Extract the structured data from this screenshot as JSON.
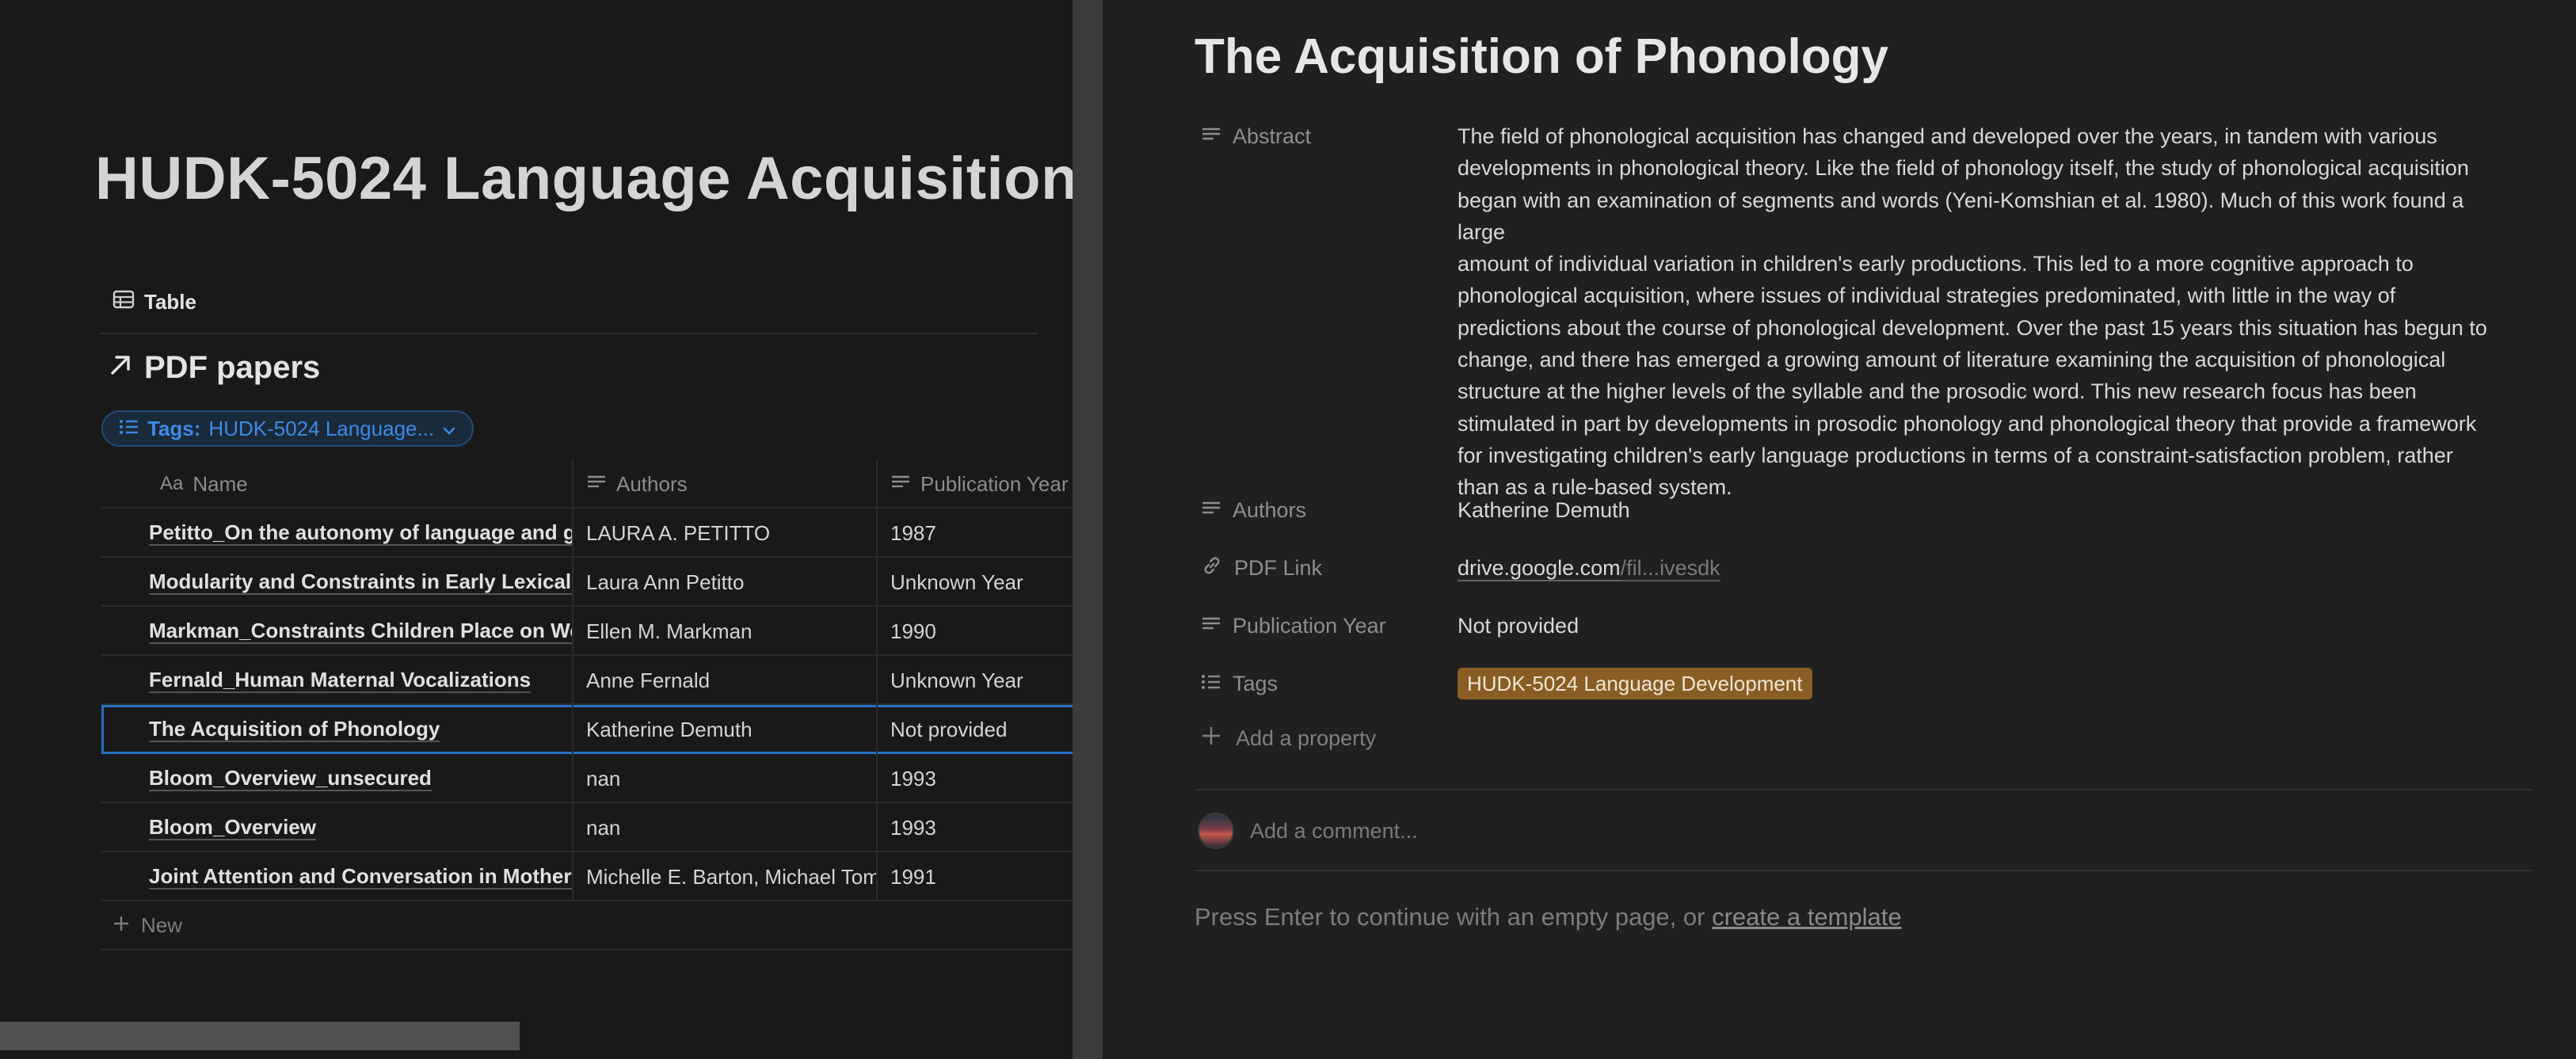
{
  "left": {
    "page_title": "HUDK-5024 Language Acquisition",
    "view_tab": "Table",
    "database_title": "PDF papers",
    "filter": {
      "key": "Tags:",
      "value": "HUDK-5024 Language..."
    },
    "columns": [
      "Name",
      "Authors",
      "Publication Year"
    ],
    "rows": [
      {
        "name": "Petitto_On the autonomy of language and gesture",
        "authors": "LAURA A. PETITTO",
        "year": "1987"
      },
      {
        "name": "Modularity and Constraints in Early Lexical Acquisition",
        "authors": "Laura Ann Petitto",
        "year": "Unknown Year"
      },
      {
        "name": "Markman_Constraints Children Place on Word Meanings",
        "authors": "Ellen M. Markman",
        "year": "1990"
      },
      {
        "name": "Fernald_Human Maternal Vocalizations",
        "authors": "Anne Fernald",
        "year": "Unknown Year"
      },
      {
        "name": "The Acquisition of Phonology",
        "authors": "Katherine Demuth",
        "year": "Not provided"
      },
      {
        "name": "Bloom_Overview_unsecured",
        "authors": "nan",
        "year": "1993"
      },
      {
        "name": "Bloom_Overview",
        "authors": "nan",
        "year": "1993"
      },
      {
        "name": "Joint Attention and Conversation in Mother-Infant Interaction",
        "authors": "Michelle E. Barton, Michael Tomasello",
        "year": "1991"
      }
    ],
    "new_label": "New"
  },
  "right": {
    "title": "The Acquisition of Phonology",
    "properties": {
      "abstract_label": "Abstract",
      "abstract_lines": [
        "The field of phonological acquisition has changed and developed over the years, in tandem with various",
        "developments in phonological theory. Like the field of phonology itself, the study of phonological acquisition",
        "began with an examination of segments and words (Yeni-Komshian et al. 1980). Much of this work found a large",
        "amount of individual variation in children's early productions. This led to a more cognitive approach to",
        "phonological acquisition, where issues of individual strategies predominated, with little in the way of",
        "predictions about the course of phonological development. Over the past 15 years this situation has begun to",
        "change, and there has emerged a growing amount of literature examining the acquisition of phonological",
        "structure at the higher levels of the syllable and the prosodic word. This new research focus has been",
        "stimulated in part by developments in prosodic phonology and phonological theory that provide a framework",
        "for investigating children's early language productions in terms of a constraint-satisfaction problem, rather",
        "than as a rule-based system."
      ],
      "authors_label": "Authors",
      "authors_value": "Katherine Demuth",
      "pdf_label": "PDF Link",
      "pdf_host": "drive.google.com",
      "pdf_path": "/fil...ivesdk",
      "year_label": "Publication Year",
      "year_value": "Not provided",
      "tags_label": "Tags",
      "tag_value": "HUDK-5024 Language Development"
    },
    "add_property": "Add a property",
    "comment_placeholder": "Add a comment...",
    "hint_prefix": "Press Enter to continue with an empty page, or ",
    "hint_link": "create a template"
  },
  "colors": {
    "tag_bg": "#8a5d24",
    "selection": "#2a6fc4",
    "filter_accent": "#3b8be5"
  }
}
